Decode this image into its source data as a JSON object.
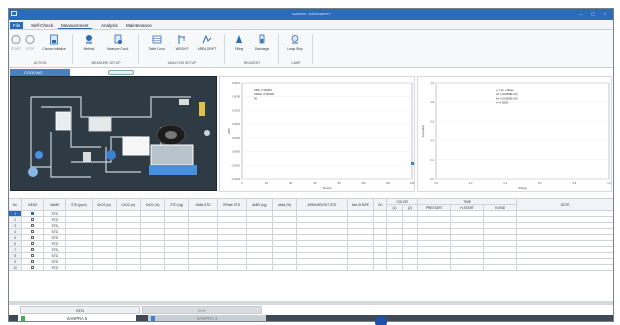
{
  "window": {
    "title": "SANPRA5 - INSTRUMENT1",
    "controls": [
      "—",
      "▢",
      "×"
    ]
  },
  "menu": {
    "items": [
      "File",
      "Self-Check",
      "Measurement",
      "Analysis",
      "Maintenance"
    ],
    "active": "File",
    "selected": "Measurement"
  },
  "ribbon": {
    "buttons": [
      {
        "id": "start",
        "label": "START",
        "icon": "start-icon",
        "disabled": true
      },
      {
        "id": "stop",
        "label": "STOP",
        "icon": "stop-icon",
        "disabled": true
      },
      {
        "id": "column-initialize",
        "label": "Column initialize",
        "icon": "column-icon"
      },
      {
        "id": "method",
        "label": "Method",
        "icon": "method-icon"
      },
      {
        "id": "measure-cond",
        "label": "Measure Cond.",
        "icon": "measure-icon"
      },
      {
        "id": "table-cond",
        "label": "Table Cond.",
        "icon": "table-icon"
      },
      {
        "id": "weight",
        "label": "WEIGHT",
        "icon": "weight-icon"
      },
      {
        "id": "area-drift",
        "label": "AREA DRIFT",
        "icon": "drift-icon"
      },
      {
        "id": "filling",
        "label": "Filling",
        "icon": "filling-icon"
      },
      {
        "id": "discharge",
        "label": "Discharge",
        "icon": "discharge-icon"
      },
      {
        "id": "lamp-stop",
        "label": "Lamp Stop",
        "icon": "lamp-icon"
      }
    ],
    "groups": [
      "ACTION",
      "MEASURE SETUP",
      "ANALYSIS SETUP",
      "REAGENT",
      "LAMP"
    ]
  },
  "schematic": {
    "tab_label": "COOLING"
  },
  "chart1": {
    "legend": [
      "ABS: 0.00000",
      "AREA: 0.00000",
      "00"
    ],
    "xlabel": "Time(s)",
    "ylabel": "ABS",
    "y_ticks": [
      "0.0010",
      "0.0008",
      "0.0006",
      "0.0004",
      "0.0002",
      "0.0000",
      "-0.0002",
      "-0.0004"
    ],
    "x_ticks": [
      "0",
      "20",
      "40",
      "60",
      "80",
      "100",
      "120",
      "140"
    ]
  },
  "chart2": {
    "legend": [
      "y = ax + Base",
      "a= 1.00000E+00",
      "b= 0.00000E+00",
      "r= 0.0000"
    ],
    "xlabel": "Wt(ug)",
    "ylabel": "Area(abs)",
    "y_ticks": [
      "1.0",
      "0.8",
      "0.6",
      "0.4",
      "0.2",
      "0.0"
    ],
    "x_ticks": [
      "0.0",
      "0.2",
      "0.4",
      "0.6",
      "0.8",
      "1.0"
    ]
  },
  "table": {
    "headers": [
      "No.",
      "MEAS",
      "NAME",
      "STD (ppm)",
      "SnO2 (m)",
      "CuO2 (m)",
      "SnO2 (m)",
      "STD (ng)",
      "dABs STD",
      "RPeak STD",
      "dABS (ng)",
      "dAbs (%)",
      "AREA/HEIGHT STD",
      "Abs SHAPE",
      "CH",
      "COLOR",
      "TIME",
      "NOTE"
    ],
    "subheaders": {
      "color": [
        "(1)",
        "(2)"
      ],
      "time": [
        "PRESTART",
        "H-START",
        "H-END"
      ]
    },
    "rows": [
      {
        "no": "1",
        "checked": true,
        "name": "STD"
      },
      {
        "no": "2",
        "checked": false,
        "name": "STD"
      },
      {
        "no": "3",
        "checked": false,
        "name": "STD"
      },
      {
        "no": "4",
        "checked": false,
        "name": "STD"
      },
      {
        "no": "5",
        "checked": false,
        "name": "STD"
      },
      {
        "no": "6",
        "checked": false,
        "name": "STD"
      },
      {
        "no": "7",
        "checked": false,
        "name": "STD"
      },
      {
        "no": "8",
        "checked": false,
        "name": "STD"
      },
      {
        "no": "9",
        "checked": false,
        "name": "STD"
      },
      {
        "no": "10",
        "checked": false,
        "name": "STD"
      }
    ]
  },
  "bottom_tabs": [
    "STD",
    "SMP"
  ],
  "status_tabs": [
    "SANPRA 5",
    "SANPRA 3"
  ],
  "colors": {
    "accent": "#2b6cb8",
    "titlebar": "#2b6cb8",
    "schematic_bg": "#2e3a44",
    "ok": "#3fb24d"
  }
}
